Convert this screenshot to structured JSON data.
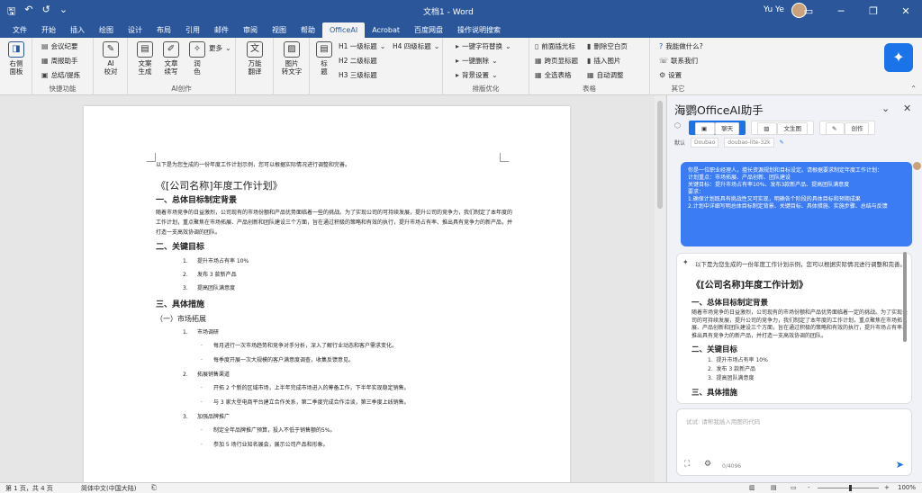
{
  "titlebar": {
    "title": "文档1 - Word",
    "user": "Yu Ye",
    "save_icon": "save-icon",
    "undo_icon": "undo-icon",
    "redo_icon": "redo-icon",
    "customize_icon": "customize-icon"
  },
  "tabs": [
    "文件",
    "开始",
    "插入",
    "绘图",
    "设计",
    "布局",
    "引用",
    "邮件",
    "审阅",
    "视图",
    "帮助",
    "OfficeAI",
    "Acrobat",
    "百度网盘",
    "操作说明搜索"
  ],
  "active_tab": "OfficeAI",
  "ribbon": {
    "panel_btn": "右侧\n面板",
    "meeting": "会议纪要",
    "weekly": "周报助手",
    "summary": "总结/提炼",
    "group_fast": "快捷功能",
    "ai_check": "AI\n校对",
    "gen": "文案\n生成",
    "continue": "文章\n续写",
    "polish": "润\n色",
    "more": "更多",
    "group_ai": "AI创作",
    "translate": "万能\n翻译",
    "pic2text": "图片\n转文字",
    "heading": "标\n题",
    "h1": "H1 一级标题",
    "h2": "H2 二级标题",
    "h3": "H3 三级标题",
    "h4": "H4 四级标题",
    "one_key_replace": "一键字符替换",
    "one_key_delete": "一键删除",
    "bg_setting": "背景设置",
    "group_layout": "排版优化",
    "del_before": "前面插光标",
    "cross_page": "跨页显标题",
    "select_all": "全选表格",
    "del_blank": "删除空白页",
    "insert_pic": "插入图片",
    "auto_adjust": "自动调整",
    "group_table": "表格",
    "what_can": "我能做什么?",
    "contact": "联系我们",
    "settings": "设置",
    "group_other": "其它"
  },
  "document": {
    "intro": "以下是为您生成的一份年度工作计划示例，您可以根据实际情况进行调整和完善。",
    "title": "《[公司名称]年度工作计划》",
    "s1": "一、总体目标制定背景",
    "s1_body": "随着市场竞争的日益激烈，公司现有的市场份额和产品优势面临着一些的挑战。为了实现公司的可持续发展，提升公司的竞争力，我们制定了本年度的工作计划，重点聚焦在市场拓展、产品创新和团队建设三个方面，旨在通过积极的策略和有效的执行，提升市场占有率、推出具有竞争力的新产品，并打造一支高效协调的团队。",
    "s2": "二、关键目标",
    "goals": [
      "提升市场占有率 10%",
      "发布 3 款新产品",
      "提高团队满意度"
    ],
    "s3": "三、具体措施",
    "s3_1": "（一）市场拓展",
    "m1": "市场调研",
    "m1_items": [
      "每月进行一次市场趋势和竞争对手分析，深入了解行业动态和客户需求变化。",
      "每季度开展一次大规模的客户满意度调查，收集反馈意见。"
    ],
    "m2": "拓展销售渠道",
    "m2_items": [
      "开拓 2 个新的区域市场，上半年完成市场进入的筹备工作，下半年实现稳定销售。",
      "与 3 家大型电商平台建立合作关系，第二季度完成合作洽谈，第三季度上线销售。"
    ],
    "m3": "加强品牌推广",
    "m3_items": [
      "制定全年品牌推广预算，投入不低于销售额的5%。",
      "参加 5 场行业知名展会，展示公司产品和形象。"
    ]
  },
  "panel": {
    "title": "海鹦OfficeAI助手",
    "tabs": [
      "聊天",
      "文生图",
      "创作"
    ],
    "default_label": "默认",
    "model_a": "Doubao",
    "model_b": "doubao-lite-32k",
    "prompt": "你是一位职业经理人，擅长资源规划和目标设定。请根据要求制定年度工作计划：\n计划重点：市场拓展、产品创新、团队建设\n关键目标：提升市场占有率10%、发布3款新产品、提高团队满意度\n要求：\n1.确保计划既具有挑战性又可实现，明确各个阶段的具体目标和预期成果\n2.计划中详细写明总体目标制定背景、关键目标、具体措施、实施步骤、总结与反馈",
    "answer_intro": "以下是为您生成的一份年度工作计划示例，您可以根据实际情况进行调整和完善。",
    "answer_title": "《[公司名称]年度工作计划》",
    "answer_s1": "一、总体目标制定背景",
    "answer_s1_body": "随着市场竞争的日益激烈，公司现有的市场份额和产品优势面临着一定的挑战。为了实现公司的可持续发展，提升公司的竞争力，我们制定了本年度的工作计划，重点聚焦在市场拓展、产品创新和团队建设三个方面，旨在通过积极的策略和有效的执行，提升市场占有率、推出具有竞争力的新产品，并打造一支高效协调的团队。",
    "answer_s2": "二、关键目标",
    "answer_goals": [
      "提升市场占有率 10%",
      "发布 3 款新产品",
      "提高团队满意度"
    ],
    "answer_s3": "三、具体措施",
    "input_placeholder": "试试: 请帮我插入用图的代码",
    "counter": "0/4096"
  },
  "status": {
    "page": "第 1 页，共 4 页",
    "lang": "简体中文(中国大陆)",
    "zoom_minus": "-",
    "zoom_plus": "+",
    "zoom": "100%"
  }
}
